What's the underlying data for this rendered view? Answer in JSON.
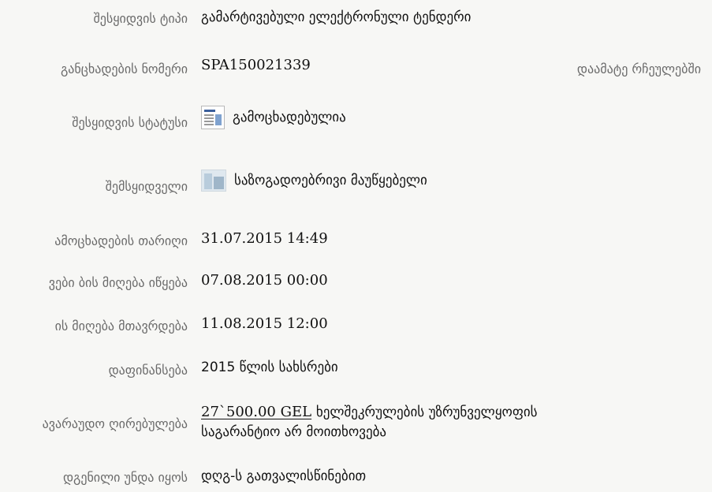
{
  "fields": {
    "procurement_type": {
      "label": "შესყიდვის ტიპი",
      "value": "გამარტივებული ელექტრონული ტენდერი"
    },
    "announcement_number": {
      "label": "განცხადების ნომერი",
      "value": "SPA150021339"
    },
    "add_to_favorites": "დაამატე რჩეულებში",
    "procurement_status": {
      "label": "შესყიდვის სტატუსი",
      "value": "გამოცხადებულია",
      "icon": "document-status-icon"
    },
    "procuring_entity": {
      "label": "შემსყიდველი",
      "value": "საზოგადოებრივი მაუწყებელი",
      "icon": "organization-icon"
    },
    "announcement_date": {
      "label": "ამოცხადების თარიღი",
      "value": "31.07.2015 14:49"
    },
    "bids_start": {
      "label": "ვები ბის მიღება იწყება",
      "value": "07.08.2015 00:00"
    },
    "bids_end": {
      "label": "ის მიღება მთავრდება",
      "value": "11.08.2015 12:00"
    },
    "funding": {
      "label": "დაფინანსება",
      "value": "2015 წლის სახსრები"
    },
    "estimated_value": {
      "label": "ავარაუდო ღირებულება",
      "amount": "27`500.00 GEL",
      "note_line1": "ხელშეკრულების უზრუნველყოფის",
      "note_line2": "საგარანტიო არ მოითხოვება"
    },
    "price_presentation": {
      "label": "დგენილი უნდა იყოს",
      "value": "დღგ-ს გათვალისწინებით"
    }
  }
}
